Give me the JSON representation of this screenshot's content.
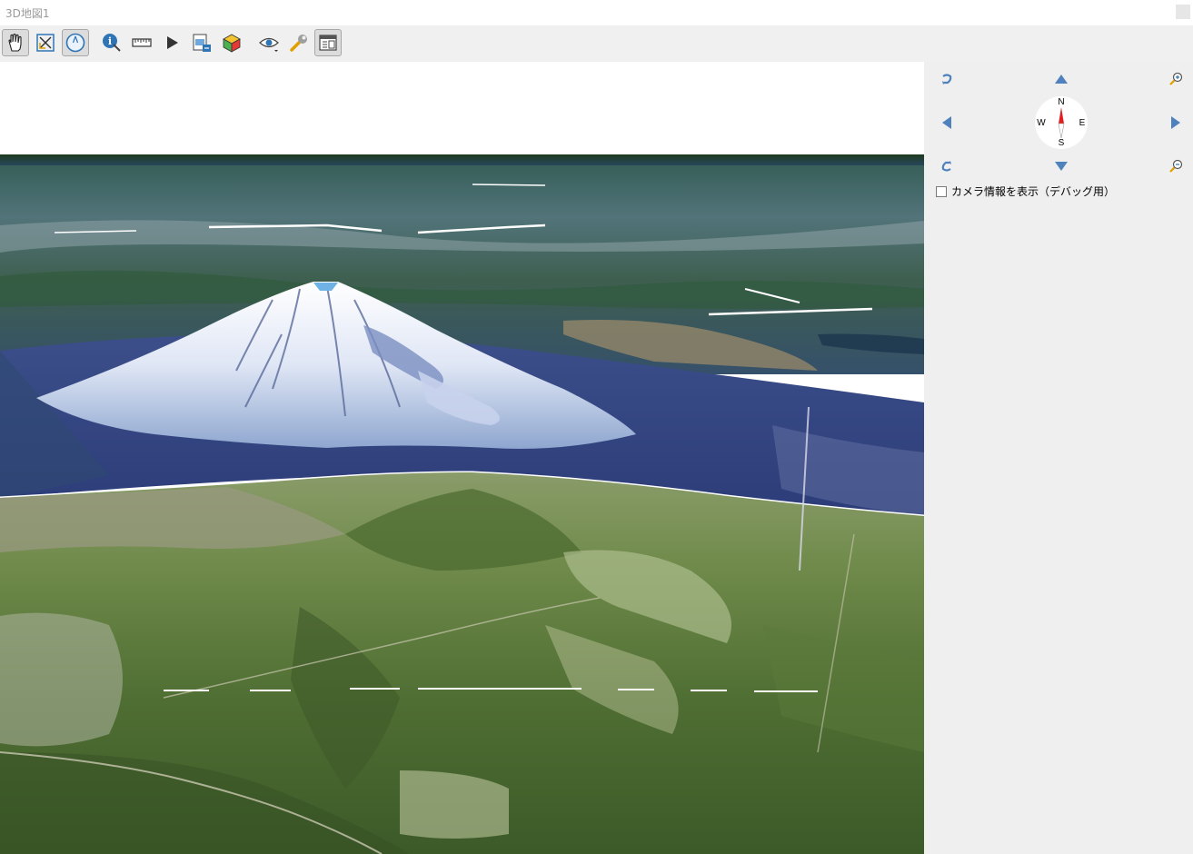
{
  "window": {
    "title": "3D地図1"
  },
  "toolbar": {
    "tools": [
      {
        "id": "pan",
        "icon": "hand-icon",
        "active": true
      },
      {
        "id": "zoom-full",
        "icon": "zoom-full-extent-icon",
        "active": false
      },
      {
        "id": "camera",
        "icon": "camera-orbit-icon",
        "active": true
      },
      {
        "id": "identify",
        "icon": "identify-icon",
        "active": false
      },
      {
        "id": "measure",
        "icon": "ruler-icon",
        "active": false
      },
      {
        "id": "animation",
        "icon": "play-icon",
        "active": false
      },
      {
        "id": "export-image",
        "icon": "export-image-icon",
        "active": false
      },
      {
        "id": "export-3d",
        "icon": "cube-icon",
        "active": false
      },
      {
        "id": "view",
        "icon": "eye-icon",
        "active": false
      },
      {
        "id": "settings",
        "icon": "wrench-icon",
        "active": false
      },
      {
        "id": "nav-panel",
        "icon": "navigation-panel-icon",
        "active": true
      }
    ]
  },
  "navigation": {
    "compass": {
      "n": "N",
      "s": "S",
      "e": "E",
      "w": "W"
    },
    "debug_checkbox": {
      "label": "カメラ情報を表示（デバッグ用）",
      "checked": false
    }
  },
  "colors": {
    "accent_blue": "#2f75b5",
    "nav_arrow": "#4f81bd",
    "needle_red": "#e02020"
  }
}
